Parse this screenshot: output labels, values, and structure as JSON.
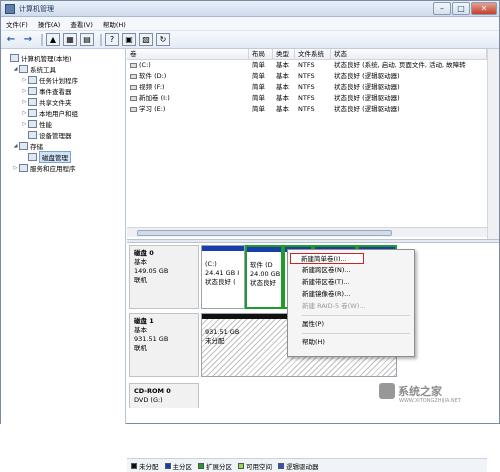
{
  "window": {
    "title": "计算机管理"
  },
  "menu": [
    "文件(F)",
    "操作(A)",
    "查看(V)",
    "帮助(H)"
  ],
  "tree": [
    {
      "label": "计算机管理(本地)",
      "level": 0,
      "twisty": ""
    },
    {
      "label": "系统工具",
      "level": 1,
      "twisty": "◢"
    },
    {
      "label": "任务计划程序",
      "level": 2,
      "twisty": "▷"
    },
    {
      "label": "事件查看器",
      "level": 2,
      "twisty": "▷"
    },
    {
      "label": "共享文件夹",
      "level": 2,
      "twisty": "▷"
    },
    {
      "label": "本地用户和组",
      "level": 2,
      "twisty": "▷"
    },
    {
      "label": "性能",
      "level": 2,
      "twisty": "▷"
    },
    {
      "label": "设备管理器",
      "level": 2,
      "twisty": ""
    },
    {
      "label": "存储",
      "level": 1,
      "twisty": "◢"
    },
    {
      "label": "磁盘管理",
      "level": 2,
      "twisty": "",
      "selected": true
    },
    {
      "label": "服务和应用程序",
      "level": 1,
      "twisty": "▷"
    }
  ],
  "volumes": {
    "headers": [
      "卷",
      "布局",
      "类型",
      "文件系统",
      "状态"
    ],
    "rows": [
      [
        "(C:)",
        "简单",
        "基本",
        "NTFS",
        "状态良好 (系统, 启动, 页面文件, 活动, 故障转"
      ],
      [
        "软件 (D:)",
        "简单",
        "基本",
        "NTFS",
        "状态良好 (逻辑驱动器)"
      ],
      [
        "视频 (F:)",
        "简单",
        "基本",
        "NTFS",
        "状态良好 (逻辑驱动器)"
      ],
      [
        "新加卷 (I:)",
        "简单",
        "基本",
        "NTFS",
        "状态良好 (逻辑驱动器)"
      ],
      [
        "学习 (E:)",
        "简单",
        "基本",
        "NTFS",
        "状态良好 (逻辑驱动器)"
      ]
    ]
  },
  "disks": [
    {
      "name": "磁盘 0",
      "type": "基本",
      "size": "149.05 GB",
      "status": "联机",
      "parts": [
        {
          "title": "(C:)",
          "line2": "24.41 GB I",
          "line3": "状态良好 (",
          "kind": "primary"
        },
        {
          "title": "软件 (D",
          "line2": "24.00 GB",
          "line3": "状态良好",
          "kind": "ext"
        },
        {
          "title": "",
          "line2": "",
          "line3": "",
          "kind": "ext"
        },
        {
          "title": "(F:)",
          "line2": "GB I",
          "line3": "好 (",
          "kind": "ext"
        },
        {
          "title": "",
          "line2": "",
          "line3": "",
          "kind": "ext"
        }
      ]
    },
    {
      "name": "磁盘 1",
      "type": "基本",
      "size": "931.51 GB",
      "status": "联机",
      "parts": [
        {
          "title": "",
          "line2": "931.51 GB",
          "line3": "未分配",
          "kind": "unalloc"
        }
      ]
    },
    {
      "name": "CD-ROM 0",
      "type": "DVD (G:)",
      "size": "",
      "status": "",
      "parts": []
    }
  ],
  "context_menu": [
    {
      "label": "新建简单卷(I)...",
      "state": "highlight"
    },
    {
      "label": "新建跨区卷(N)...",
      "state": "enabled"
    },
    {
      "label": "新建带区卷(T)...",
      "state": "enabled"
    },
    {
      "label": "新建镜像卷(R)...",
      "state": "enabled"
    },
    {
      "label": "新建 RAID-5 卷(W)...",
      "state": "disabled"
    },
    {
      "sep": true
    },
    {
      "label": "属性(P)",
      "state": "enabled"
    },
    {
      "sep": true
    },
    {
      "label": "帮助(H)",
      "state": "enabled"
    }
  ],
  "legend": [
    {
      "label": "未分配",
      "color": "#111111"
    },
    {
      "label": "主分区",
      "color": "#1a3ea8"
    },
    {
      "label": "扩展分区",
      "color": "#1e9b2b"
    },
    {
      "label": "可用空间",
      "color": "#8fdb4a"
    },
    {
      "label": "逻辑驱动器",
      "color": "#3050c8"
    }
  ],
  "watermark": {
    "brand": "系统之家",
    "url": "WWW.XITONGZHIJIA.NET"
  }
}
